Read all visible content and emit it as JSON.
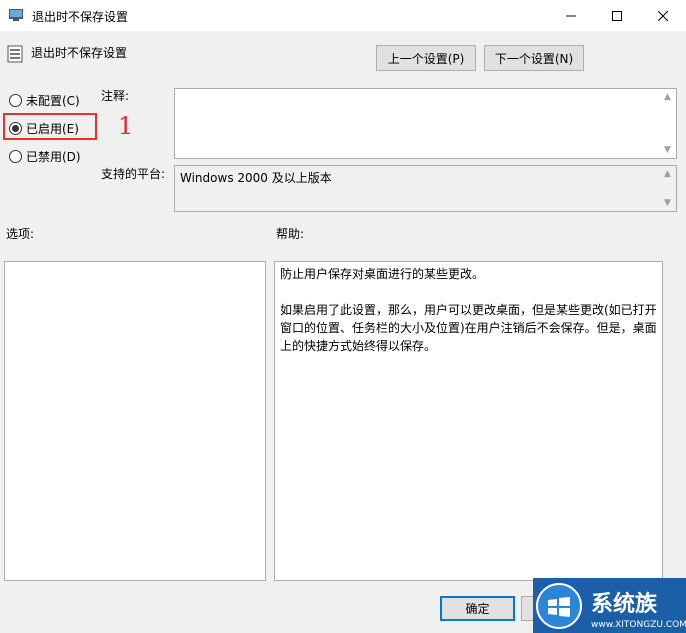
{
  "window": {
    "title": "退出时不保存设置",
    "controls": [
      "minimize",
      "maximize",
      "close"
    ]
  },
  "header": {
    "setting_name": "退出时不保存设置",
    "prev_button": "上一个设置(P)",
    "next_button": "下一个设置(N)"
  },
  "state": {
    "options": [
      {
        "label": "未配置(C)",
        "checked": false
      },
      {
        "label": "已启用(E)",
        "checked": true
      },
      {
        "label": "已禁用(D)",
        "checked": false
      }
    ],
    "annotation_number": "1"
  },
  "comment": {
    "label": "注释:",
    "value": ""
  },
  "platform": {
    "label": "支持的平台:",
    "value": "Windows 2000 及以上版本"
  },
  "options_section": {
    "label": "选项:"
  },
  "help_section": {
    "label": "帮助:",
    "text": "防止用户保存对桌面进行的某些更改。\n\n如果启用了此设置，那么，用户可以更改桌面，但是某些更改(如已打开窗口的位置、任务栏的大小及位置)在用户注销后不会保存。但是，桌面上的快捷方式始终得以保存。"
  },
  "footer": {
    "ok_button": "确定"
  },
  "watermark": {
    "brand": "系统族",
    "url": "www.XITONGZU.COM"
  },
  "colors": {
    "highlight": "#e53333",
    "annotation": "#e0272f",
    "accent": "#0078d7"
  }
}
